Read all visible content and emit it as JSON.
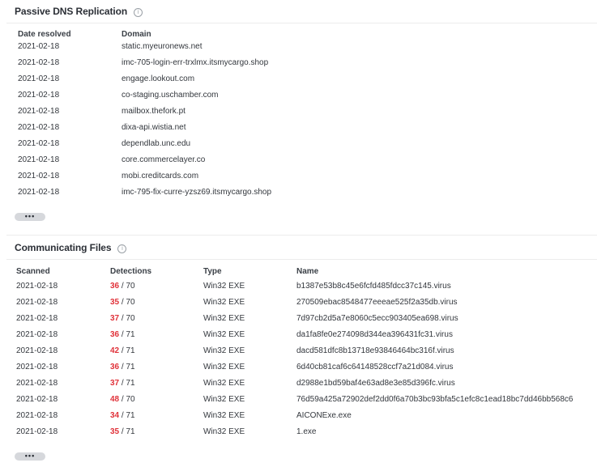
{
  "dns": {
    "title": "Passive DNS Replication",
    "info_icon": "info-icon",
    "headers": {
      "date": "Date resolved",
      "domain": "Domain"
    },
    "rows": [
      {
        "date": "2021-02-18",
        "domain": "static.myeuronews.net"
      },
      {
        "date": "2021-02-18",
        "domain": "imc-705-login-err-trxlmx.itsmycargo.shop"
      },
      {
        "date": "2021-02-18",
        "domain": "engage.lookout.com"
      },
      {
        "date": "2021-02-18",
        "domain": "co-staging.uschamber.com"
      },
      {
        "date": "2021-02-18",
        "domain": "mailbox.thefork.pt"
      },
      {
        "date": "2021-02-18",
        "domain": "dixa-api.wistia.net"
      },
      {
        "date": "2021-02-18",
        "domain": "dependlab.unc.edu"
      },
      {
        "date": "2021-02-18",
        "domain": "core.commercelayer.co"
      },
      {
        "date": "2021-02-18",
        "domain": "mobi.creditcards.com"
      },
      {
        "date": "2021-02-18",
        "domain": "imc-795-fix-curre-yzsz69.itsmycargo.shop"
      }
    ],
    "more_label": "•••"
  },
  "files": {
    "title": "Communicating Files",
    "info_icon": "info-icon",
    "headers": {
      "scanned": "Scanned",
      "detections": "Detections",
      "type": "Type",
      "name": "Name"
    },
    "rows": [
      {
        "scanned": "2021-02-18",
        "det": "36",
        "total": " / 70",
        "type": "Win32 EXE",
        "name": "b1387e53b8c45e6fcfd485fdcc37c145.virus"
      },
      {
        "scanned": "2021-02-18",
        "det": "35",
        "total": " / 70",
        "type": "Win32 EXE",
        "name": "270509ebac8548477eeeae525f2a35db.virus"
      },
      {
        "scanned": "2021-02-18",
        "det": "37",
        "total": " / 70",
        "type": "Win32 EXE",
        "name": "7d97cb2d5a7e8060c5ecc903405ea698.virus"
      },
      {
        "scanned": "2021-02-18",
        "det": "36",
        "total": " / 71",
        "type": "Win32 EXE",
        "name": "da1fa8fe0e274098d344ea396431fc31.virus"
      },
      {
        "scanned": "2021-02-18",
        "det": "42",
        "total": " / 71",
        "type": "Win32 EXE",
        "name": "dacd581dfc8b13718e93846464bc316f.virus"
      },
      {
        "scanned": "2021-02-18",
        "det": "36",
        "total": " / 71",
        "type": "Win32 EXE",
        "name": "6d40cb81caf6c64148528ccf7a21d084.virus"
      },
      {
        "scanned": "2021-02-18",
        "det": "37",
        "total": " / 71",
        "type": "Win32 EXE",
        "name": "d2988e1bd59baf4e63ad8e3e85d396fc.virus"
      },
      {
        "scanned": "2021-02-18",
        "det": "48",
        "total": " / 70",
        "type": "Win32 EXE",
        "name": "76d59a425a72902def2dd0f6a70b3bc93bfa5c1efc8c1ead18bc7dd46bb568c6"
      },
      {
        "scanned": "2021-02-18",
        "det": "34",
        "total": " / 71",
        "type": "Win32 EXE",
        "name": "AICONExe.exe"
      },
      {
        "scanned": "2021-02-18",
        "det": "35",
        "total": " / 71",
        "type": "Win32 EXE",
        "name": "1.exe"
      }
    ],
    "more_label": "•••"
  },
  "colors": {
    "detection": "#e0323a",
    "button": "#d6d8dc"
  }
}
